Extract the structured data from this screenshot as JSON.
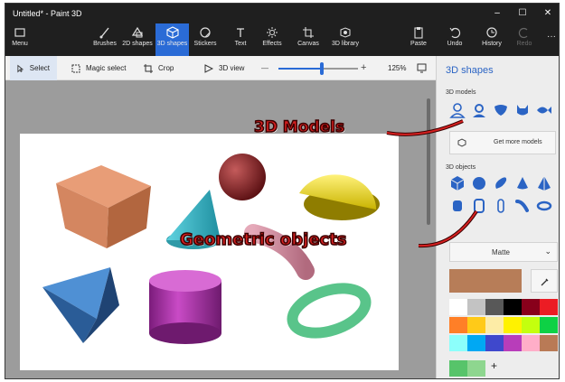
{
  "window": {
    "title": "Untitled* - Paint 3D"
  },
  "ribbon": {
    "menu": "Menu",
    "brushes": "Brushes",
    "shapes2d": "2D shapes",
    "shapes3d": "3D shapes",
    "stickers": "Stickers",
    "text": "Text",
    "effects": "Effects",
    "canvas": "Canvas",
    "library": "3D library",
    "paste": "Paste",
    "undo": "Undo",
    "history": "History",
    "redo": "Redo"
  },
  "toolbar": {
    "select": "Select",
    "magic_select": "Magic select",
    "crop": "Crop",
    "view3d": "3D view",
    "zoom_minus": "—",
    "zoom_plus": "+",
    "zoom_level": "125%",
    "zoom_fraction": 0.55
  },
  "panel": {
    "title": "3D shapes",
    "models_label": "3D models",
    "get_more": "Get more models",
    "objects_label": "3D objects",
    "material": "Matte",
    "add": "+",
    "current_color": "#b77d58",
    "swatches": [
      "#ffffff",
      "#c3c3c3",
      "#585858",
      "#000000",
      "#88001b",
      "#ec1c24",
      "#ff7f27",
      "#ffca18",
      "#fdeca6",
      "#fff200",
      "#c4ff0e",
      "#0ed145",
      "#8cfffb",
      "#00a8f3",
      "#3f48cc",
      "#b83dba",
      "#ffaec8",
      "#b97a56"
    ],
    "custom_swatches": [
      "#57c46a",
      "#8ed68f"
    ]
  },
  "annotations": {
    "models": "3D Models",
    "objects": "Geometric objects"
  },
  "colors": {
    "accent": "#2a6bd6",
    "annotation": "#d62020"
  }
}
